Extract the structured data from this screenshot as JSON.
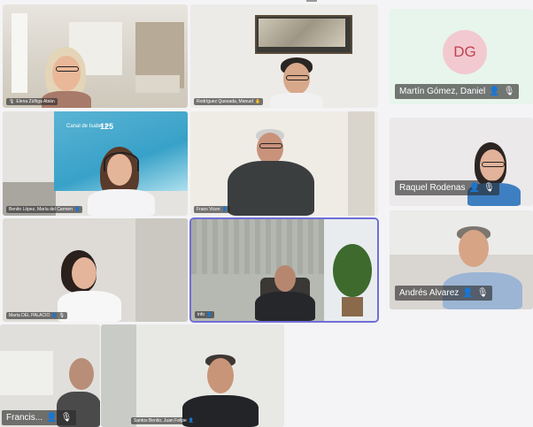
{
  "participants": [
    {
      "name": "Elena Zúñiga Abián",
      "mic": "muted"
    },
    {
      "name": "Rodríguez Quesada, Manuel",
      "mic": "muted"
    },
    {
      "name": "Martín Gómez, Daniel",
      "initials": "DG",
      "mic": "muted"
    },
    {
      "name": "Benito López, María del Carmen",
      "mic": "muted"
    },
    {
      "name": "Frans Vicen",
      "mic": "muted"
    },
    {
      "name": "Raquel Rodenas",
      "mic": "muted"
    },
    {
      "name": "Marta DEL PALACIO",
      "mic": "muted"
    },
    {
      "name": "info",
      "mic": "muted"
    },
    {
      "name": "Andrés Alvarez",
      "mic": "muted"
    },
    {
      "name": "Francis...",
      "mic": "muted"
    },
    {
      "name": "Santos Benito, Juan Felipe",
      "mic": "muted"
    }
  ],
  "banner": {
    "brand": "Canal de Isabel II",
    "number": "125"
  },
  "colors": {
    "avatar_bg": "#f2c9cf",
    "avatar_text": "#c2424f",
    "active_border": "#6f6fd6"
  }
}
